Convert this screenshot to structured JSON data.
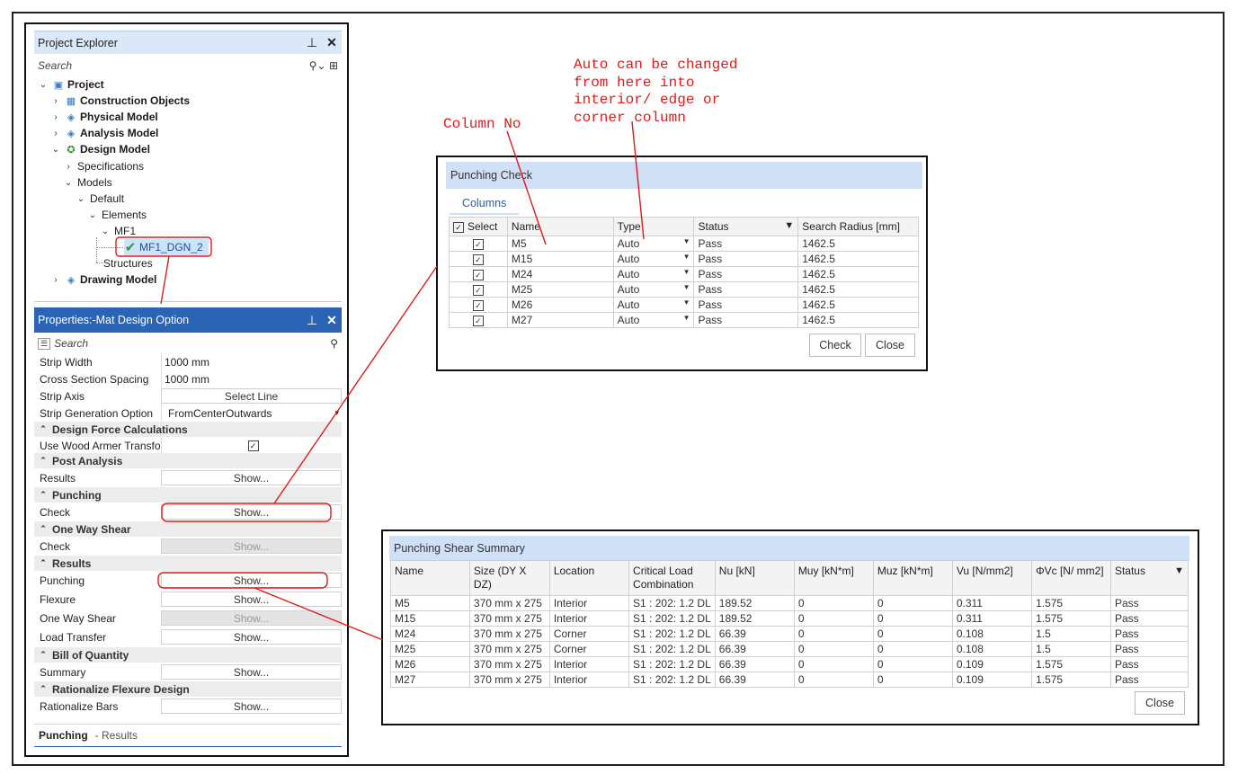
{
  "project_explorer": {
    "title": "Project Explorer",
    "pin_icon": "pin-icon",
    "close_icon": "close-icon",
    "search_placeholder": "Search",
    "tree": [
      {
        "label": "Project",
        "bold": true
      },
      {
        "label": "Construction Objects",
        "bold": true
      },
      {
        "label": "Physical Model",
        "bold": true
      },
      {
        "label": "Analysis Model",
        "bold": true
      },
      {
        "label": "Design Model",
        "bold": true
      },
      {
        "label": "Specifications"
      },
      {
        "label": "Models"
      },
      {
        "label": "Default"
      },
      {
        "label": "Elements"
      },
      {
        "label": "MF1"
      },
      {
        "label": "MF1_DGN_2",
        "status": "checkmark-icon"
      },
      {
        "label": "Structures"
      },
      {
        "label": "Drawing Model",
        "bold": true
      }
    ]
  },
  "properties": {
    "title": "Properties:-Mat Design Option",
    "search_placeholder": "Search",
    "rows": {
      "strip_width": {
        "label": "Strip Width",
        "value": "1000 mm"
      },
      "cross_section_spacing": {
        "label": "Cross Section Spacing",
        "value": "1000 mm"
      },
      "strip_axis": {
        "label": "Strip Axis",
        "value": "Select Line"
      },
      "strip_generation": {
        "label": "Strip Generation Option",
        "value": "FromCenterOutwards"
      },
      "use_wood_armer": {
        "label": "Use Wood Armer Transfo"
      },
      "results": {
        "label": "Results",
        "value": "Show..."
      },
      "punching_check": {
        "label": "Check",
        "value": "Show..."
      },
      "one_way_check": {
        "label": "Check",
        "value": "Show..."
      },
      "res_punching": {
        "label": "Punching",
        "value": "Show..."
      },
      "res_flexure": {
        "label": "Flexure",
        "value": "Show..."
      },
      "res_one_way": {
        "label": "One Way Shear",
        "value": "Show..."
      },
      "res_load_transfer": {
        "label": "Load Transfer",
        "value": "Show..."
      },
      "boq_summary": {
        "label": "Summary",
        "value": "Show..."
      },
      "rationalize_bars": {
        "label": "Rationalize Bars",
        "value": "Show..."
      }
    },
    "categories": {
      "design_force": "Design Force Calculations",
      "post_analysis": "Post Analysis",
      "punching": "Punching",
      "one_way_shear": "One Way Shear",
      "results": "Results",
      "bill_of_quantity": "Bill of Quantity",
      "rationalize_flexure": "Rationalize Flexure Design"
    },
    "description": {
      "title": "Punching",
      "sub": "- Results"
    }
  },
  "punching_check": {
    "title": "Punching Check",
    "tab": "Columns",
    "columns": [
      "Select",
      "Name",
      "Type",
      "Status",
      "Search Radius [mm]"
    ],
    "rows": [
      {
        "name": "M5",
        "type": "Auto",
        "status": "Pass",
        "radius": "1462.5"
      },
      {
        "name": "M15",
        "type": "Auto",
        "status": "Pass",
        "radius": "1462.5"
      },
      {
        "name": "M24",
        "type": "Auto",
        "status": "Pass",
        "radius": "1462.5"
      },
      {
        "name": "M25",
        "type": "Auto",
        "status": "Pass",
        "radius": "1462.5"
      },
      {
        "name": "M26",
        "type": "Auto",
        "status": "Pass",
        "radius": "1462.5"
      },
      {
        "name": "M27",
        "type": "Auto",
        "status": "Pass",
        "radius": "1462.5"
      }
    ],
    "check_button": "Check",
    "close_button": "Close"
  },
  "punching_summary": {
    "title": "Punching Shear Summary",
    "columns": [
      "Name",
      "Size (DY X DZ)",
      "Location",
      "Critical Load Combination",
      "Nu [kN]",
      "Muy [kN*m]",
      "Muz [kN*m]",
      "Vu [N/mm2]",
      "ΦVc [N/ mm2]",
      "Status"
    ],
    "rows": [
      [
        "M5",
        "370 mm x 275",
        "Interior",
        "S1 : 202: 1.2 DL",
        "189.52",
        "0",
        "0",
        "0.311",
        "1.575",
        "Pass"
      ],
      [
        "M15",
        "370 mm x 275",
        "Interior",
        "S1 : 202: 1.2 DL",
        "189.52",
        "0",
        "0",
        "0.311",
        "1.575",
        "Pass"
      ],
      [
        "M24",
        "370 mm x 275",
        "Corner",
        "S1 : 202: 1.2 DL",
        "66.39",
        "0",
        "0",
        "0.108",
        "1.5",
        "Pass"
      ],
      [
        "M25",
        "370 mm x 275",
        "Corner",
        "S1 : 202: 1.2 DL",
        "66.39",
        "0",
        "0",
        "0.108",
        "1.5",
        "Pass"
      ],
      [
        "M26",
        "370 mm x 275",
        "Interior",
        "S1 : 202: 1.2 DL",
        "66.39",
        "0",
        "0",
        "0.109",
        "1.575",
        "Pass"
      ],
      [
        "M27",
        "370 mm x 275",
        "Interior",
        "S1 : 202: 1.2 DL",
        "66.39",
        "0",
        "0",
        "0.109",
        "1.575",
        "Pass"
      ]
    ],
    "close_button": "Close"
  },
  "annotations": {
    "column_no": "Column No",
    "auto_note": "Auto can be changed\nfrom here into\ninterior/ edge or\ncorner column"
  },
  "colors": {
    "annotation": "#e01b1b",
    "header_blue": "#2c64b5",
    "dialog_title": "#cfe0f7"
  }
}
